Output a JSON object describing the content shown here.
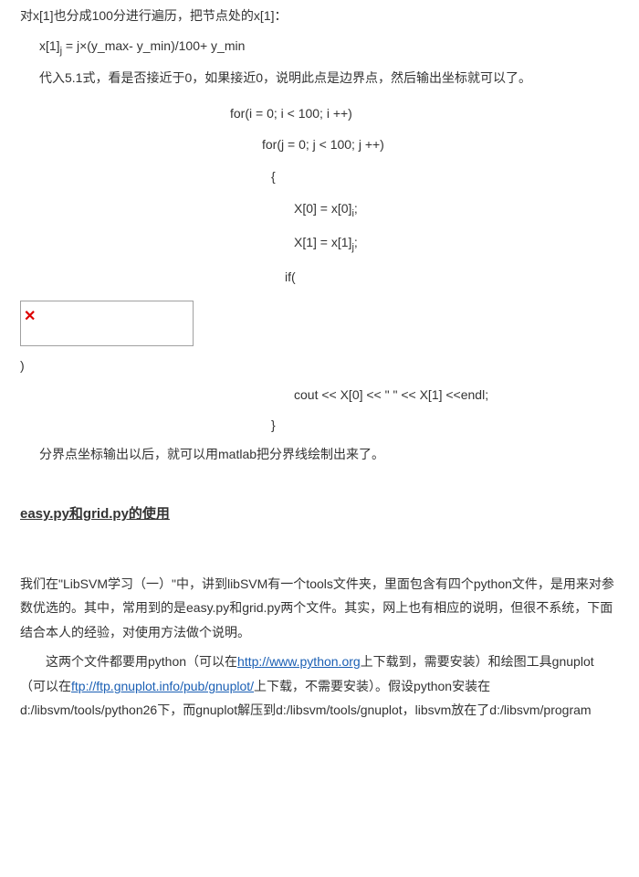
{
  "p1": "对x[1]也分成100分进行遍历，把节点处的x[1]：",
  "formula1_pre": "x[1]",
  "formula1_sub": "j",
  "formula1_post": " = j×(y_max- y_min)/100+ y_min",
  "p2": "代入5.1式，看是否接近于0，如果接近0，说明此点是边界点，然后输出坐标就可以了。",
  "code": {
    "l1": "for(i = 0; i < 100; i ++)",
    "l2": "for(j = 0; j < 100; j ++)",
    "l3": "{",
    "l4_pre": "X[0] = x[0]",
    "l4_sub": "i",
    "l4_post": ";",
    "l5_pre": "X[1] = x[1]",
    "l5_sub": "j",
    "l5_post": ";",
    "l6": "if(",
    "l7": ")",
    "l8": "cout << X[0] <<   \"   \" <<  X[1] <<endl;",
    "l9": "}"
  },
  "p3": "分界点坐标输出以后，就可以用matlab把分界线绘制出来了。",
  "section_title": "easy.py和grid.py的使用",
  "p4": "我们在\"LibSVM学习（一）\"中，讲到libSVM有一个tools文件夹，里面包含有四个python文件，是用来对参数优选的。其中，常用到的是easy.py和grid.py两个文件。其实，网上也有相应的说明，但很不系统，下面结合本人的经验，对使用方法做个说明。",
  "p5a": "这两个文件都要用python（可以在",
  "link1_text": "http://www.python.org",
  "p5b": "上下载到，需要安装）和绘图工具gnuplot（可以在",
  "link2_text": "ftp://ftp.gnuplot.info/pub/gnuplot/",
  "p5c": "上下载，不需要安装）。假设python安装在d:/libsvm/tools/python26下，而gnuplot解压到d:/libsvm/tools/gnuplot，libsvm放在了d:/libsvm/program"
}
